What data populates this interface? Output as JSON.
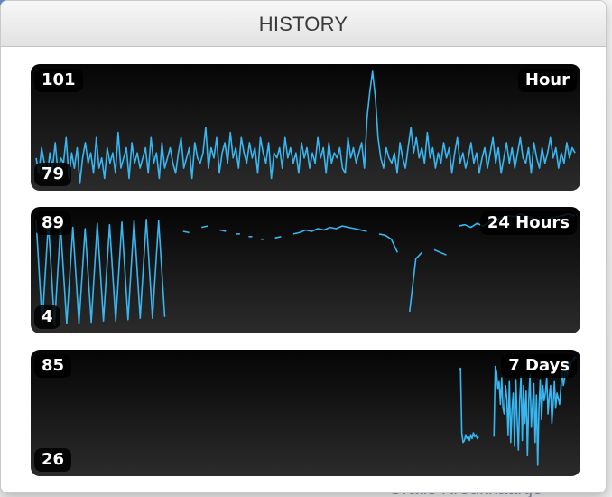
{
  "popover": {
    "title": "HISTORY"
  },
  "graphs": [
    {
      "period": "Hour",
      "max": "101",
      "min": "79",
      "values": [
        84,
        81,
        86,
        83,
        80,
        85,
        82,
        87,
        81,
        84,
        83,
        88,
        80,
        85,
        82,
        86,
        79,
        84,
        87,
        83,
        85,
        81,
        88,
        82,
        84,
        80,
        86,
        83,
        85,
        81,
        89,
        82,
        84,
        86,
        80,
        87,
        83,
        85,
        82,
        84,
        86,
        81,
        88,
        83,
        85,
        80,
        87,
        82,
        84,
        86,
        83,
        81,
        85,
        88,
        82,
        84,
        86,
        80,
        87,
        84,
        83,
        85,
        90,
        82,
        86,
        84,
        88,
        81,
        85,
        87,
        83,
        89,
        84,
        86,
        82,
        88,
        85,
        83,
        87,
        84,
        86,
        81,
        88,
        85,
        83,
        87,
        80,
        85,
        84,
        86,
        82,
        88,
        84,
        86,
        83,
        85,
        81,
        87,
        84,
        86,
        82,
        85,
        83,
        88,
        84,
        86,
        81,
        87,
        83,
        85,
        84,
        86,
        82,
        81,
        88,
        84,
        86,
        83,
        85,
        87,
        82,
        92,
        97,
        101,
        96,
        88,
        84,
        82,
        86,
        84,
        83,
        85,
        81,
        87,
        84,
        82,
        86,
        90,
        85,
        88,
        84,
        86,
        83,
        89,
        84,
        86,
        82,
        85,
        83,
        87,
        84,
        86,
        81,
        85,
        88,
        83,
        85,
        82,
        84,
        87,
        83,
        85,
        81,
        84,
        86,
        82,
        85,
        88,
        83,
        86,
        81,
        84,
        87,
        83,
        86,
        82,
        85,
        88,
        84,
        83,
        86,
        81,
        87,
        84,
        82,
        86,
        83,
        85,
        88,
        84,
        86,
        82,
        85,
        83,
        87,
        84,
        86,
        85
      ]
    },
    {
      "period": "24 Hours",
      "max": "89",
      "min": "4",
      "values": [
        84,
        6,
        83,
        5,
        80,
        6,
        79,
        6,
        78,
        7,
        82,
        8,
        81,
        8,
        83,
        9,
        84,
        10,
        85,
        10,
        84,
        11,
        null,
        null,
        76,
        75,
        null,
        79,
        80,
        null,
        77,
        76,
        null,
        74,
        null,
        72,
        null,
        70,
        null,
        71,
        72,
        null,
        74,
        75,
        77,
        76,
        78,
        77,
        79,
        78,
        80,
        79,
        78,
        77,
        76,
        null,
        74,
        73,
        70,
        60,
        null,
        15,
        55,
        60,
        null,
        62,
        60,
        58,
        null,
        80,
        81,
        79,
        82,
        80,
        83,
        84,
        86,
        88,
        87,
        89,
        88,
        86,
        85,
        84,
        86,
        87,
        88,
        89,
        88
      ]
    },
    {
      "period": "7 Days",
      "max": "85",
      "min": "26",
      "values": [
        null,
        null,
        null,
        null,
        null,
        null,
        null,
        null,
        null,
        null,
        null,
        null,
        null,
        null,
        null,
        null,
        null,
        null,
        null,
        null,
        null,
        null,
        null,
        null,
        null,
        null,
        null,
        null,
        null,
        null,
        null,
        null,
        null,
        null,
        null,
        null,
        null,
        null,
        null,
        null,
        null,
        null,
        null,
        null,
        null,
        null,
        null,
        null,
        null,
        null,
        null,
        null,
        null,
        null,
        null,
        null,
        null,
        null,
        null,
        null,
        null,
        null,
        null,
        null,
        null,
        null,
        null,
        null,
        null,
        null,
        null,
        null,
        null,
        null,
        null,
        null,
        null,
        null,
        null,
        null,
        null,
        null,
        null,
        null,
        null,
        null,
        null,
        null,
        null,
        null,
        null,
        null,
        null,
        null,
        null,
        null,
        null,
        null,
        null,
        null,
        null,
        null,
        null,
        null,
        null,
        null,
        null,
        null,
        null,
        null,
        null,
        null,
        null,
        null,
        null,
        null,
        null,
        null,
        null,
        null,
        null,
        null,
        null,
        null,
        null,
        null,
        null,
        null,
        null,
        null,
        null,
        null,
        null,
        null,
        null,
        null,
        null,
        null,
        null,
        null,
        null,
        null,
        null,
        null,
        null,
        null,
        null,
        null,
        null,
        null,
        null,
        null,
        null,
        null,
        null,
        null,
        null,
        null,
        null,
        null,
        null,
        null,
        null,
        null,
        null,
        null,
        null,
        null,
        null,
        null,
        null,
        null,
        null,
        null,
        null,
        null,
        null,
        null,
        null,
        null,
        null,
        null,
        null,
        null,
        null,
        null,
        null,
        null,
        null,
        null,
        null,
        null,
        null,
        null,
        null,
        null,
        null,
        null,
        null,
        null,
        null,
        null,
        null,
        null,
        null,
        null,
        null,
        null,
        null,
        null,
        null,
        null,
        null,
        null,
        null,
        null,
        null,
        null,
        null,
        null,
        null,
        null,
        null,
        null,
        null,
        null,
        null,
        null,
        null,
        null,
        null,
        null,
        null,
        null,
        null,
        null,
        null,
        null,
        null,
        null,
        null,
        null,
        null,
        null,
        null,
        null,
        null,
        null,
        null,
        null,
        null,
        null,
        null,
        null,
        null,
        null,
        null,
        null,
        null,
        null,
        null,
        null,
        null,
        null,
        null,
        null,
        null,
        null,
        null,
        null,
        null,
        null,
        null,
        null,
        null,
        null,
        null,
        null,
        null,
        null,
        null,
        null,
        null,
        null,
        null,
        null,
        null,
        null,
        null,
        null,
        null,
        null,
        null,
        null,
        null,
        null,
        null,
        null,
        null,
        null,
        null,
        null,
        null,
        null,
        null,
        null,
        null,
        null,
        null,
        null,
        null,
        null,
        null,
        null,
        null,
        null,
        null,
        null,
        null,
        null,
        null,
        null,
        null,
        null,
        null,
        null,
        null,
        null,
        null,
        78,
        79,
        45,
        40,
        41,
        44,
        42,
        43,
        41,
        44,
        42,
        45,
        43,
        44,
        42,
        43,
        null,
        null,
        null,
        null,
        null,
        null,
        null,
        null,
        null,
        null,
        null,
        43,
        80,
        77,
        68,
        72,
        60,
        74,
        58,
        55,
        70,
        63,
        44,
        72,
        40,
        57,
        66,
        38,
        73,
        52,
        36,
        62,
        75,
        41,
        70,
        50,
        67,
        33,
        61,
        76,
        48,
        60,
        71,
        40,
        65,
        28,
        58,
        73,
        52,
        70,
        62,
        66,
        74,
        55,
        64,
        70,
        50,
        60,
        72,
        58,
        66,
        63,
        60,
        68,
        78,
        70,
        74,
        80,
        75,
        82,
        79,
        82,
        83,
        84,
        85
      ]
    }
  ],
  "background": {
    "partial_text": "Gratis Kreditkaartje"
  },
  "colors": {
    "line": "#38b6f0"
  }
}
